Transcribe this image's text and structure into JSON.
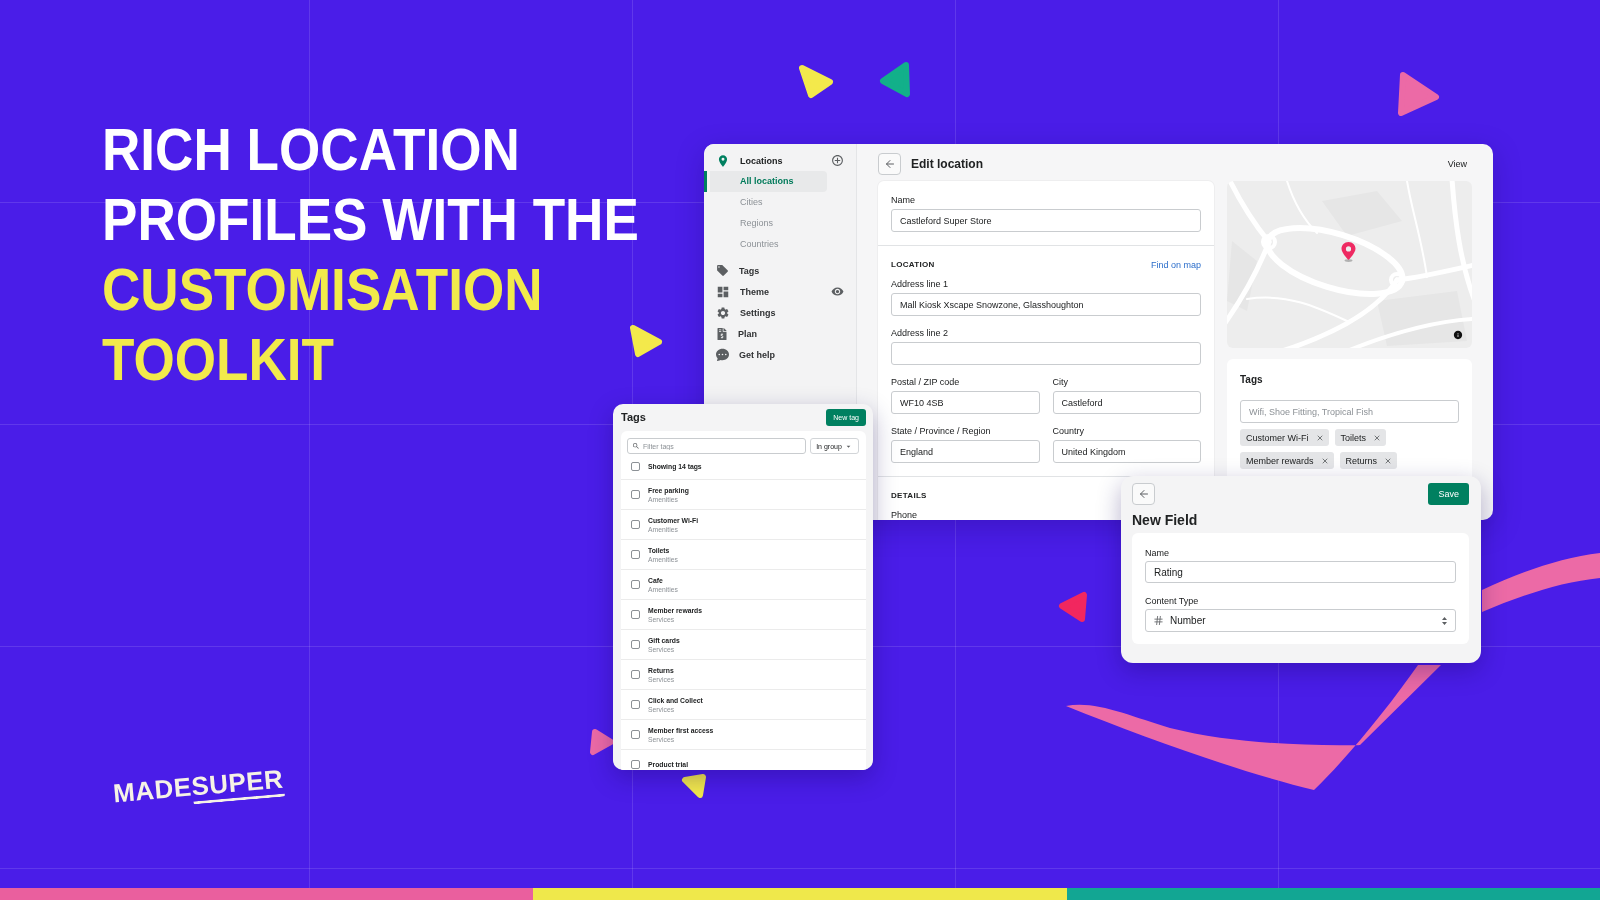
{
  "headline": {
    "lines": [
      {
        "text": "RICH LOCATION",
        "color": "#ffffff"
      },
      {
        "text": "PROFILES WITH THE",
        "color": "#ffffff"
      },
      {
        "text": "CUSTOMISATION",
        "color": "#f2ea4b"
      },
      {
        "text": "TOOLKIT",
        "color": "#f2ea4b"
      }
    ]
  },
  "logo": {
    "text": "MADE",
    "underlined_text": "SUPER"
  },
  "sidebar": {
    "items": [
      {
        "label": "Locations",
        "selected": true,
        "children": [
          {
            "label": "All locations",
            "selected": true
          },
          {
            "label": "Cities",
            "selected": false
          },
          {
            "label": "Regions",
            "selected": false
          },
          {
            "label": "Countries",
            "selected": false
          }
        ]
      },
      {
        "label": "Tags",
        "selected": false
      },
      {
        "label": "Theme",
        "selected": false
      },
      {
        "label": "Settings",
        "selected": false
      },
      {
        "label": "Plan",
        "selected": false
      },
      {
        "label": "Get help",
        "selected": false
      }
    ]
  },
  "editor": {
    "title": "Edit location",
    "view_link": "View",
    "sections": [
      {
        "rows": [
          [
            {
              "kind": "input",
              "label": "Name",
              "value": "Castleford Super Store"
            }
          ]
        ]
      },
      {
        "heading": "LOCATION",
        "link": "Find on map",
        "rows": [
          [
            {
              "kind": "input",
              "label": "Address line 1",
              "value": "Mall Kiosk Xscape Snowzone, Glasshoughton"
            }
          ],
          [
            {
              "kind": "input",
              "label": "Address line 2"
            }
          ],
          [
            {
              "kind": "input",
              "label": "Postal / ZIP code",
              "value": "WF10 4SB"
            },
            {
              "kind": "input",
              "label": "City",
              "value": "Castleford"
            }
          ],
          [
            {
              "kind": "input",
              "label": "State / Province / Region",
              "value": "England"
            },
            {
              "kind": "input",
              "label": "Country",
              "value": "United Kingdom"
            }
          ]
        ]
      },
      {
        "heading": "DETAILS",
        "rows": [
          [
            {
              "kind": "label",
              "label": "Phone"
            }
          ]
        ]
      }
    ]
  },
  "tags_card": {
    "title": "Tags",
    "placeholder": "Wifi, Shoe Fitting, Tropical Fish",
    "chips": [
      {
        "label": "Customer Wi-Fi"
      },
      {
        "label": "Toilets"
      },
      {
        "label": "Member rewards"
      },
      {
        "label": "Returns"
      }
    ]
  },
  "tags_panel": {
    "title": "Tags",
    "button": "New tag",
    "filter": {
      "placeholder": "Filter tags"
    },
    "group_select": {
      "value": "In group"
    },
    "summary": {
      "label": "Showing 14 tags",
      "checked": false
    },
    "rows": [
      {
        "name": "Free parking",
        "group": "Amenities",
        "checked": false
      },
      {
        "name": "Customer Wi-Fi",
        "group": "Amenities",
        "checked": false
      },
      {
        "name": "Toilets",
        "group": "Amenities",
        "checked": false
      },
      {
        "name": "Cafe",
        "group": "Amenities",
        "checked": false
      },
      {
        "name": "Member rewards",
        "group": "Services",
        "checked": false
      },
      {
        "name": "Gift cards",
        "group": "Services",
        "checked": false
      },
      {
        "name": "Returns",
        "group": "Services",
        "checked": false
      },
      {
        "name": "Click and Collect",
        "group": "Services",
        "checked": false
      },
      {
        "name": "Member first access",
        "group": "Services",
        "checked": false
      },
      {
        "name": "Product trial",
        "checked": false
      }
    ]
  },
  "new_field": {
    "title": "New Field",
    "save_button": "Save",
    "fields": [
      {
        "kind": "input",
        "label": "Name",
        "value": "Rating"
      },
      {
        "kind": "select",
        "label": "Content Type",
        "value": "Number"
      }
    ]
  }
}
